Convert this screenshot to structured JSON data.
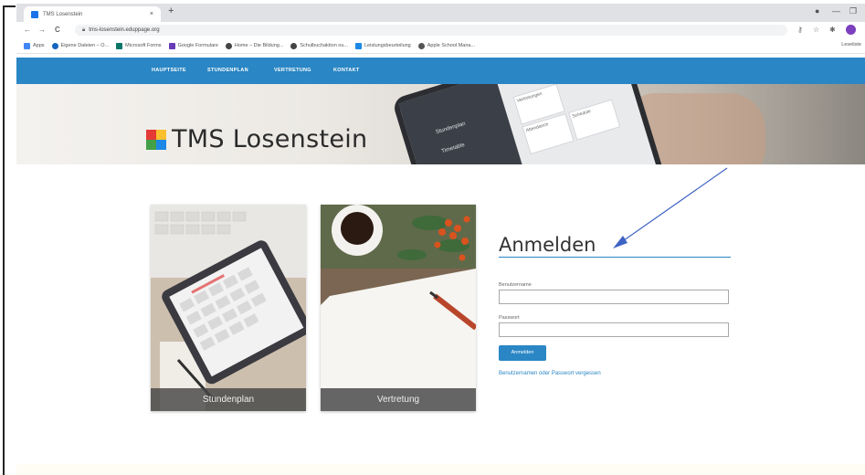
{
  "browser": {
    "tab_title": "TMS Losenstein",
    "tab_close": "×",
    "new_tab": "+",
    "url": "tms-losenstein.eduppage.org",
    "nav_back": "←",
    "nav_forward": "→",
    "nav_reload": "C",
    "window_controls": [
      "—",
      "❐"
    ],
    "bookmarks": [
      {
        "label": "Apps",
        "color": "#4285f4"
      },
      {
        "label": "Eigene Dateien – O...",
        "color": "#1565c0"
      },
      {
        "label": "Microsoft Forms",
        "color": "#077568"
      },
      {
        "label": "Google Formulare",
        "color": "#673ab7"
      },
      {
        "label": "Home – Die Bildung...",
        "color": "#444444"
      },
      {
        "label": "Schulbuchaktion ou...",
        "color": "#444444"
      },
      {
        "label": "Leistungsbeurteilung",
        "color": "#1e88e5"
      },
      {
        "label": "Apple School Mana...",
        "color": "#555555"
      }
    ],
    "bookmarks_right": "Leseliste"
  },
  "site": {
    "nav": [
      "HAUPTSEITE",
      "STUNDENPLAN",
      "VERTRETUNG",
      "KONTAKT"
    ],
    "title": "TMS Losenstein",
    "phone_labels": [
      "Stundenplan",
      "Timetable",
      "Vertretungen",
      "Attendance",
      "Schedule"
    ]
  },
  "cards": [
    {
      "label": "Stundenplan"
    },
    {
      "label": "Vertretung"
    }
  ],
  "login": {
    "heading": "Anmelden",
    "username_label": "Benutzername",
    "password_label": "Passwort",
    "submit": "Anmelden",
    "forgot": "Benutzernamen oder Passwort vergessen"
  },
  "colors": {
    "brand_blue": "#2a86c4",
    "annotation_arrow": "#3f63c4"
  },
  "icons": [
    "close-icon",
    "plus-icon",
    "back-icon",
    "forward-icon",
    "reload-icon",
    "lock-icon",
    "star-icon",
    "profile-icon"
  ]
}
